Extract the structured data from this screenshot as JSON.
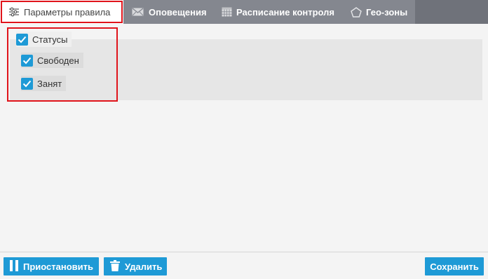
{
  "tabs": [
    {
      "label": "Параметры правила",
      "icon": "sliders-icon",
      "active": true
    },
    {
      "label": "Оповещения",
      "icon": "envelope-icon",
      "active": false
    },
    {
      "label": "Расписание контроля",
      "icon": "calendar-grid-icon",
      "active": false
    },
    {
      "label": "Гео-зоны",
      "icon": "pentagon-icon",
      "active": false
    }
  ],
  "statuses": {
    "group": {
      "label": "Статусы",
      "checked": true
    },
    "items": [
      {
        "label": "Свободен",
        "checked": true
      },
      {
        "label": "Занят",
        "checked": true
      }
    ]
  },
  "footer": {
    "pause_label": "Приостановить",
    "delete_label": "Удалить",
    "save_label": "Сохранить"
  },
  "colors": {
    "accent": "#1e9ad6",
    "tabbar": "#84878f",
    "highlight": "#e0141b"
  }
}
